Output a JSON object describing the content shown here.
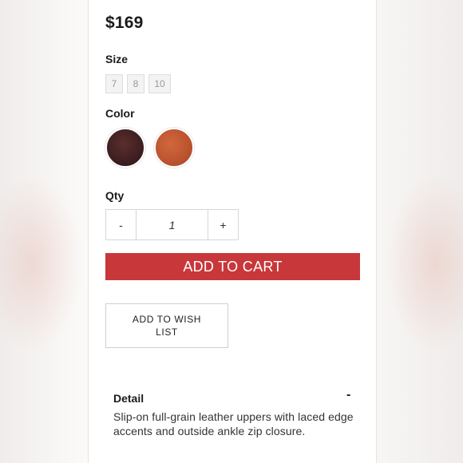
{
  "product": {
    "price": "$169"
  },
  "size": {
    "label": "Size",
    "options": [
      "7",
      "8",
      "10"
    ]
  },
  "color": {
    "label": "Color",
    "swatches": [
      {
        "name": "dark-brown",
        "hex": "#3a1c1e"
      },
      {
        "name": "rust",
        "hex": "#b8522e"
      }
    ]
  },
  "qty": {
    "label": "Qty",
    "decrement": "-",
    "value": "1",
    "increment": "+"
  },
  "actions": {
    "add_to_cart": "ADD TO CART",
    "add_to_wishlist": "ADD TO WISH LIST"
  },
  "detail": {
    "title": "Detail",
    "toggle": "-",
    "text": "Slip-on full-grain leather uppers with laced edge accents and outside ankle zip closure."
  },
  "colors": {
    "accent": "#c8373a"
  }
}
